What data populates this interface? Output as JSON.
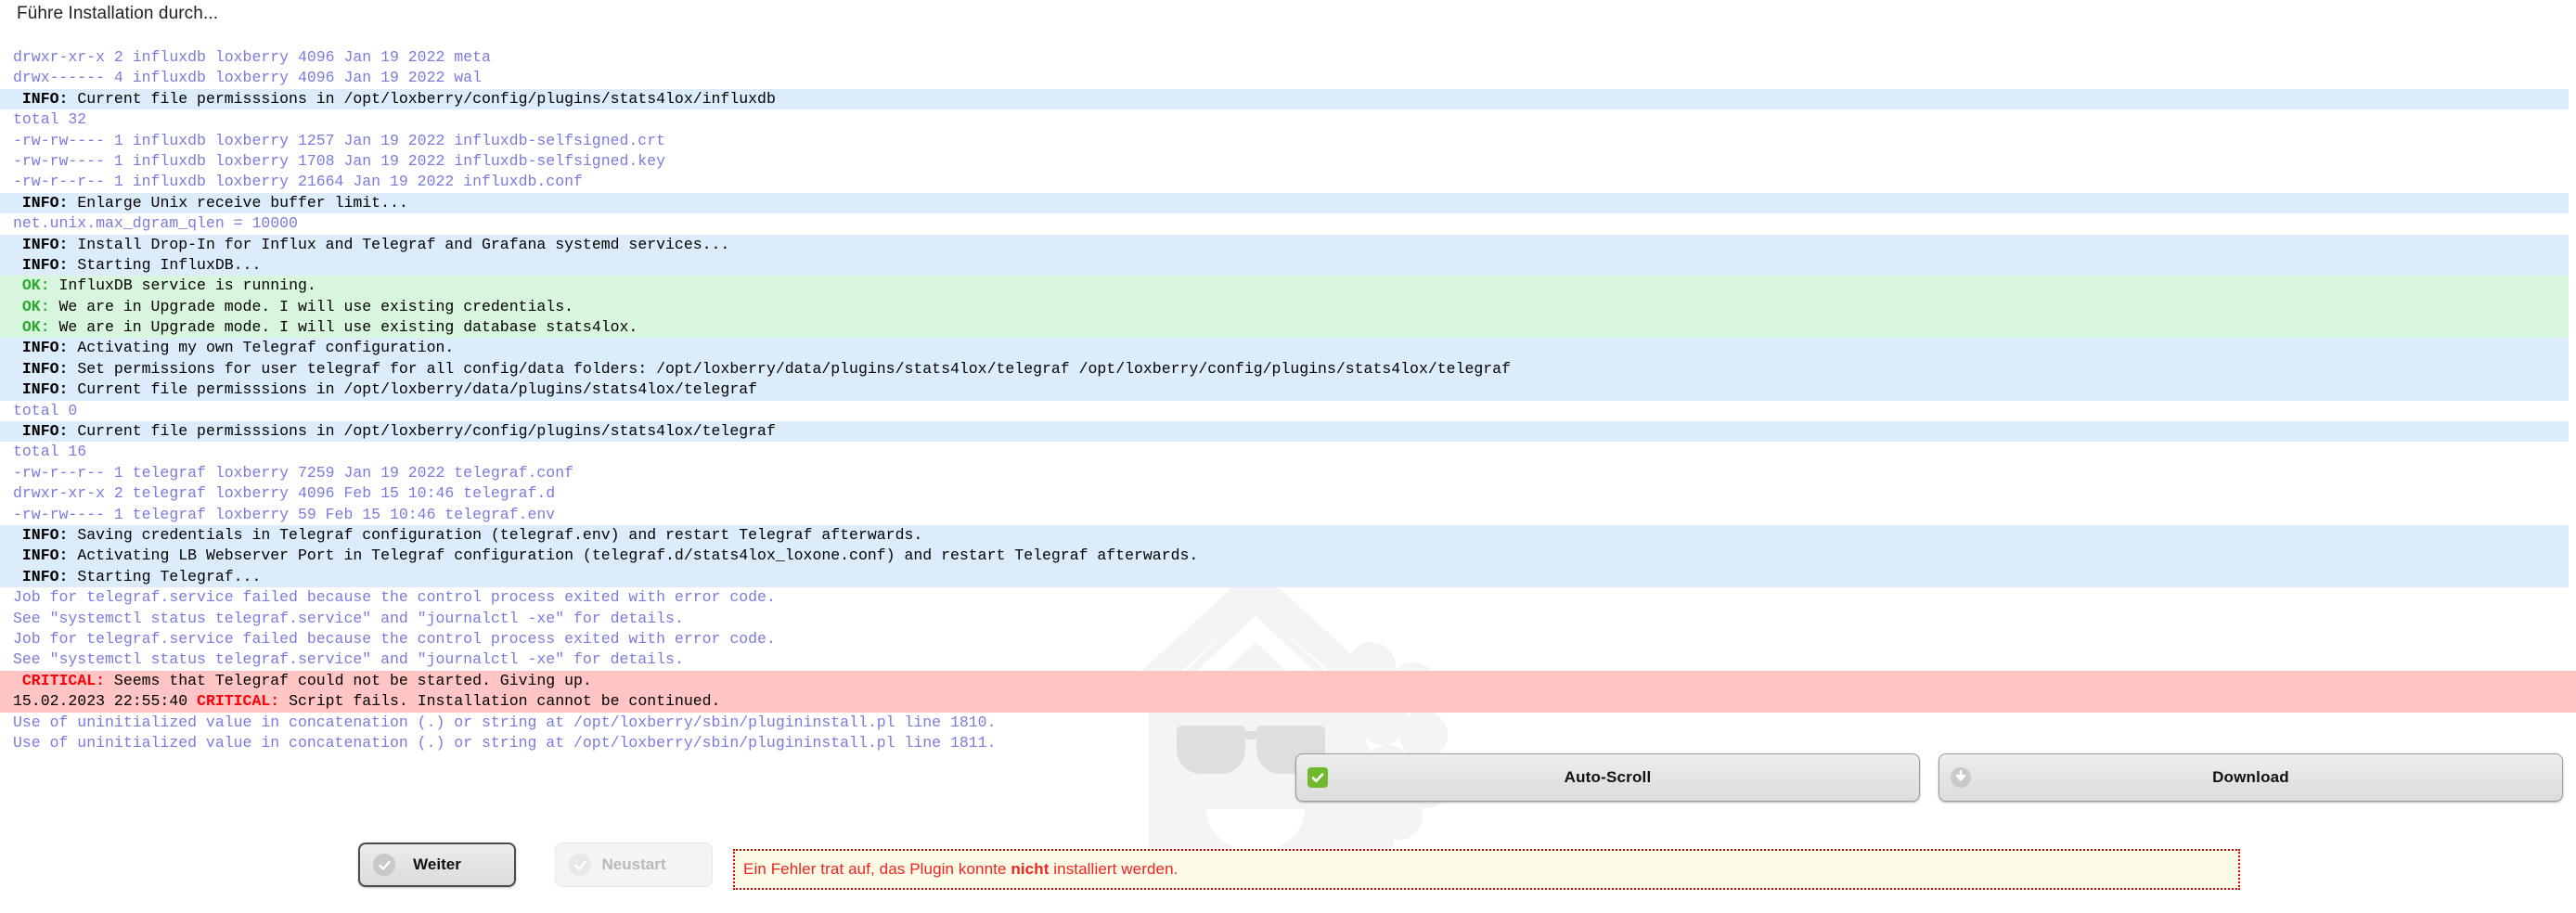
{
  "page": {
    "title": "Führe Installation durch..."
  },
  "console": {
    "lines": [
      {
        "type": "plain",
        "text": "drwxr-xr-x 2 influxdb loxberry 4096 Jan 19 2022 meta"
      },
      {
        "type": "plain",
        "text": "drwx------ 4 influxdb loxberry 4096 Jan 19 2022 wal"
      },
      {
        "type": "info",
        "tag": "INFO:",
        "msg": "Current file permisssions in /opt/loxberry/config/plugins/stats4lox/influxdb"
      },
      {
        "type": "plain",
        "text": "total 32"
      },
      {
        "type": "plain",
        "text": "-rw-rw---- 1 influxdb loxberry 1257 Jan 19 2022 influxdb-selfsigned.crt"
      },
      {
        "type": "plain",
        "text": "-rw-rw---- 1 influxdb loxberry 1708 Jan 19 2022 influxdb-selfsigned.key"
      },
      {
        "type": "plain",
        "text": "-rw-r--r-- 1 influxdb loxberry 21664 Jan 19 2022 influxdb.conf"
      },
      {
        "type": "info",
        "tag": "INFO:",
        "msg": "Enlarge Unix receive buffer limit..."
      },
      {
        "type": "plain",
        "text": "net.unix.max_dgram_qlen = 10000"
      },
      {
        "type": "info",
        "tag": "INFO:",
        "msg": "Install Drop-In for Influx and Telegraf and Grafana systemd services..."
      },
      {
        "type": "info",
        "tag": "INFO:",
        "msg": "Starting InfluxDB..."
      },
      {
        "type": "ok",
        "tag": "OK:",
        "msg": "InfluxDB service is running."
      },
      {
        "type": "ok",
        "tag": "OK:",
        "msg": "We are in Upgrade mode. I will use existing credentials."
      },
      {
        "type": "ok",
        "tag": "OK:",
        "msg": "We are in Upgrade mode. I will use existing database stats4lox."
      },
      {
        "type": "info",
        "tag": "INFO:",
        "msg": "Activating my own Telegraf configuration."
      },
      {
        "type": "info",
        "tag": "INFO:",
        "msg": "Set permissions for user telegraf for all config/data folders: /opt/loxberry/data/plugins/stats4lox/telegraf /opt/loxberry/config/plugins/stats4lox/telegraf"
      },
      {
        "type": "info",
        "tag": "INFO:",
        "msg": "Current file permisssions in /opt/loxberry/data/plugins/stats4lox/telegraf"
      },
      {
        "type": "plain",
        "text": "total 0"
      },
      {
        "type": "info",
        "tag": "INFO:",
        "msg": "Current file permisssions in /opt/loxberry/config/plugins/stats4lox/telegraf"
      },
      {
        "type": "plain",
        "text": "total 16"
      },
      {
        "type": "plain",
        "text": "-rw-r--r-- 1 telegraf loxberry 7259 Jan 19 2022 telegraf.conf"
      },
      {
        "type": "plain",
        "text": "drwxr-xr-x 2 telegraf loxberry 4096 Feb 15 10:46 telegraf.d"
      },
      {
        "type": "plain",
        "text": "-rw-rw---- 1 telegraf loxberry 59 Feb 15 10:46 telegraf.env"
      },
      {
        "type": "info",
        "tag": "INFO:",
        "msg": "Saving credentials in Telegraf configuration (telegraf.env) and restart Telegraf afterwards."
      },
      {
        "type": "info",
        "tag": "INFO:",
        "msg": "Activating LB Webserver Port in Telegraf configuration (telegraf.d/stats4lox_loxone.conf) and restart Telegraf afterwards."
      },
      {
        "type": "info",
        "tag": "INFO:",
        "msg": "Starting Telegraf..."
      },
      {
        "type": "plain",
        "text": "Job for telegraf.service failed because the control process exited with error code."
      },
      {
        "type": "plain",
        "text": "See \"systemctl status telegraf.service\" and \"journalctl -xe\" for details."
      },
      {
        "type": "plain",
        "text": "Job for telegraf.service failed because the control process exited with error code."
      },
      {
        "type": "plain",
        "text": "See \"systemctl status telegraf.service\" and \"journalctl -xe\" for details."
      },
      {
        "type": "crit",
        "tag": "CRITICAL:",
        "msg": "Seems that Telegraf could not be started. Giving up."
      },
      {
        "type": "crit",
        "timestamp": "15.02.2023 22:55:40",
        "tag": "CRITICAL:",
        "msg": "Script fails. Installation cannot be continued."
      },
      {
        "type": "plain",
        "text": "Use of uninitialized value in concatenation (.) or string at /opt/loxberry/sbin/plugininstall.pl line 1810."
      },
      {
        "type": "plain",
        "text": "Use of uninitialized value in concatenation (.) or string at /opt/loxberry/sbin/plugininstall.pl line 1811."
      }
    ]
  },
  "toolbar": {
    "autoscroll_label": "Auto-Scroll",
    "autoscroll_icon": "checkbox-checked-icon",
    "autoscroll_checked": true,
    "download_label": "Download",
    "download_icon": "download-arrow-icon"
  },
  "footer": {
    "weiter_label": "Weiter",
    "weiter_icon": "check-circle-icon",
    "neustart_label": "Neustart",
    "neustart_icon": "check-circle-icon",
    "neustart_disabled": true,
    "error_text_before": "Ein Fehler trat auf, das Plugin konnte ",
    "error_text_bold": "nicht",
    "error_text_after": " installiert werden."
  },
  "colors": {
    "info_bg": "#ddecfb",
    "ok_bg": "#d8f5de",
    "critical_bg": "#ffc4c4",
    "plain_text": "#7b7bdd",
    "ok_tag": "#2ea832",
    "critical_tag": "#fb0007",
    "error_box_bg": "#fdfbe6",
    "error_box_border": "#e00000",
    "error_text": "#ee2222",
    "checkbox_green": "#6fb92c"
  }
}
